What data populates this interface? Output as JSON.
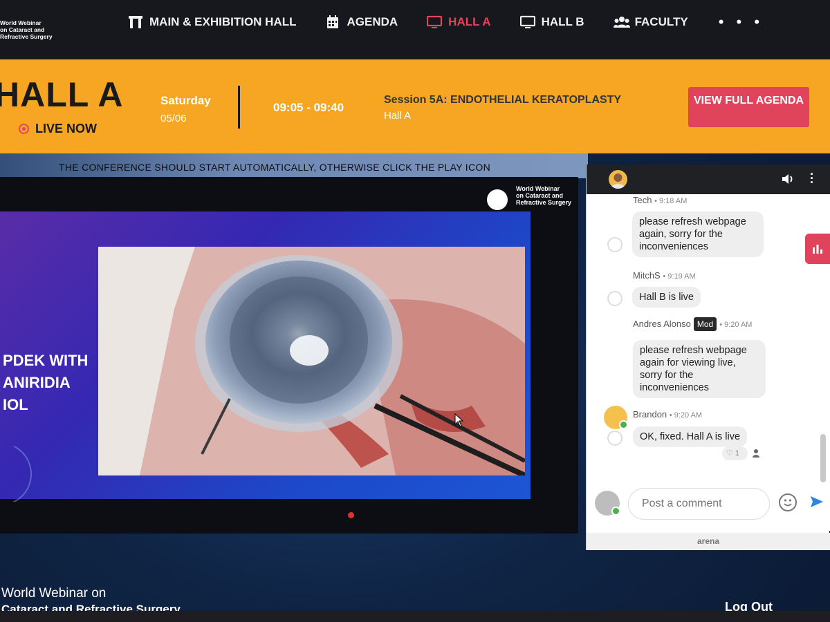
{
  "brand": {
    "lines": [
      "World Webinar",
      "on Cataract and",
      "Refractive Surgery"
    ]
  },
  "nav": {
    "items": [
      {
        "label": "MAIN & EXHIBITION HALL",
        "icon": "building-icon"
      },
      {
        "label": "AGENDA",
        "icon": "calendar-icon"
      },
      {
        "label": "HALL A",
        "icon": "monitor-icon",
        "active": true
      },
      {
        "label": "HALL B",
        "icon": "monitor-icon"
      },
      {
        "label": "FACULTY",
        "icon": "users-icon"
      }
    ],
    "more": "• • •",
    "active_color": "#e2455d"
  },
  "banner": {
    "hall_title": "HALL A",
    "live_label": "LIVE NOW",
    "day": "Saturday",
    "date": "05/06",
    "time": "09:05 - 09:40",
    "session_title": "Session 5A: ENDOTHELIAL KERATOPLASTY",
    "session_hall": "Hall A",
    "agenda_button": "VIEW FULL AGENDA",
    "color": "#f6a623",
    "button_color": "#e0445d"
  },
  "notice": "THE CONFERENCE SHOULD START AUTOMATICALLY, OTHERWISE CLICK THE PLAY ICON",
  "player": {
    "slide_lines": [
      "PDEK WITH",
      "ANIRIDIA",
      "IOL"
    ],
    "logo_lines": [
      "World Webinar",
      "on Cataract and",
      "Refractive Surgery"
    ]
  },
  "chat": {
    "messages": [
      {
        "author": "Tech",
        "time": "9:18 AM",
        "text": "please refresh webpage again, sorry for the inconveniences"
      },
      {
        "author": "MitchS",
        "time": "9:19 AM",
        "text": "Hall B is live"
      },
      {
        "author": "Andres Alonso",
        "badge": "Mod",
        "time": "9:20 AM",
        "text": "please refresh webpage again for viewing live, sorry for the inconveniences"
      },
      {
        "author": "Brandon",
        "time": "9:20 AM",
        "text": "OK, fixed. Hall A is live",
        "likes": "1"
      }
    ],
    "input_placeholder": "Post a comment",
    "footer_brand": "arena"
  },
  "footer": {
    "brand_line1": "World Webinar on",
    "brand_line2": "Cataract and Refractive Surgery",
    "logout": "Log Out"
  }
}
